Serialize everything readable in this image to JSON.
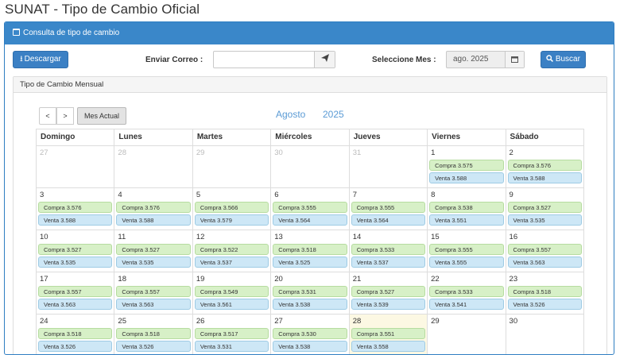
{
  "page_title": "SUNAT - Tipo de Cambio Oficial",
  "panel_header": "Consulta de tipo de cambio",
  "toolbar": {
    "download_label": "Descargar",
    "email_label": "Enviar Correo :",
    "email_value": "",
    "month_label": "Seleccione Mes :",
    "month_value": "ago. 2025",
    "search_label": "Buscar"
  },
  "sub_panel_title": "Tipo de Cambio Mensual",
  "nav": {
    "prev": "<",
    "next": ">",
    "current": "Mes Actual"
  },
  "calendar": {
    "month": "Agosto",
    "year": "2025",
    "weekdays": [
      "Domingo",
      "Lunes",
      "Martes",
      "Miércoles",
      "Jueves",
      "Viernes",
      "Sábado"
    ],
    "weeks": [
      [
        {
          "d": "27",
          "muted": true
        },
        {
          "d": "28",
          "muted": true
        },
        {
          "d": "29",
          "muted": true
        },
        {
          "d": "30",
          "muted": true
        },
        {
          "d": "31",
          "muted": true
        },
        {
          "d": "1",
          "c": "Compra 3.575",
          "v": "Venta 3.588"
        },
        {
          "d": "2",
          "c": "Compra 3.576",
          "v": "Venta 3.588"
        }
      ],
      [
        {
          "d": "3",
          "c": "Compra 3.576",
          "v": "Venta 3.588"
        },
        {
          "d": "4",
          "c": "Compra 3.576",
          "v": "Venta 3.588"
        },
        {
          "d": "5",
          "c": "Compra 3.566",
          "v": "Venta 3.579"
        },
        {
          "d": "6",
          "c": "Compra 3.555",
          "v": "Venta 3.564"
        },
        {
          "d": "7",
          "c": "Compra 3.555",
          "v": "Venta 3.564"
        },
        {
          "d": "8",
          "c": "Compra 3.538",
          "v": "Venta 3.551"
        },
        {
          "d": "9",
          "c": "Compra 3.527",
          "v": "Venta 3.535"
        }
      ],
      [
        {
          "d": "10",
          "c": "Compra 3.527",
          "v": "Venta 3.535"
        },
        {
          "d": "11",
          "c": "Compra 3.527",
          "v": "Venta 3.535"
        },
        {
          "d": "12",
          "c": "Compra 3.522",
          "v": "Venta 3.537"
        },
        {
          "d": "13",
          "c": "Compra 3.518",
          "v": "Venta 3.525"
        },
        {
          "d": "14",
          "c": "Compra 3.533",
          "v": "Venta 3.537"
        },
        {
          "d": "15",
          "c": "Compra 3.555",
          "v": "Venta 3.555"
        },
        {
          "d": "16",
          "c": "Compra 3.557",
          "v": "Venta 3.563"
        }
      ],
      [
        {
          "d": "17",
          "c": "Compra 3.557",
          "v": "Venta 3.563"
        },
        {
          "d": "18",
          "c": "Compra 3.557",
          "v": "Venta 3.563"
        },
        {
          "d": "19",
          "c": "Compra 3.549",
          "v": "Venta 3.561"
        },
        {
          "d": "20",
          "c": "Compra 3.531",
          "v": "Venta 3.538"
        },
        {
          "d": "21",
          "c": "Compra 3.527",
          "v": "Venta 3.539"
        },
        {
          "d": "22",
          "c": "Compra 3.533",
          "v": "Venta 3.541"
        },
        {
          "d": "23",
          "c": "Compra 3.518",
          "v": "Venta 3.526"
        }
      ],
      [
        {
          "d": "24",
          "c": "Compra 3.518",
          "v": "Venta 3.526"
        },
        {
          "d": "25",
          "c": "Compra 3.518",
          "v": "Venta 3.526"
        },
        {
          "d": "26",
          "c": "Compra 3.517",
          "v": "Venta 3.531"
        },
        {
          "d": "27",
          "c": "Compra 3.530",
          "v": "Venta 3.538"
        },
        {
          "d": "28",
          "c": "Compra 3.551",
          "v": "Venta 3.558",
          "today": true
        },
        {
          "d": "29"
        },
        {
          "d": "30"
        }
      ]
    ]
  },
  "icons": {
    "calendar": "calendar-icon",
    "download": "download-icon",
    "send": "send-icon",
    "search": "search-icon"
  },
  "colors": {
    "header_blue": "#3a87c9",
    "button_blue": "#3b80c4",
    "compra_green": "#d7f0c7",
    "venta_blue": "#cde7f6",
    "title_blue": "#5b9bd5"
  }
}
